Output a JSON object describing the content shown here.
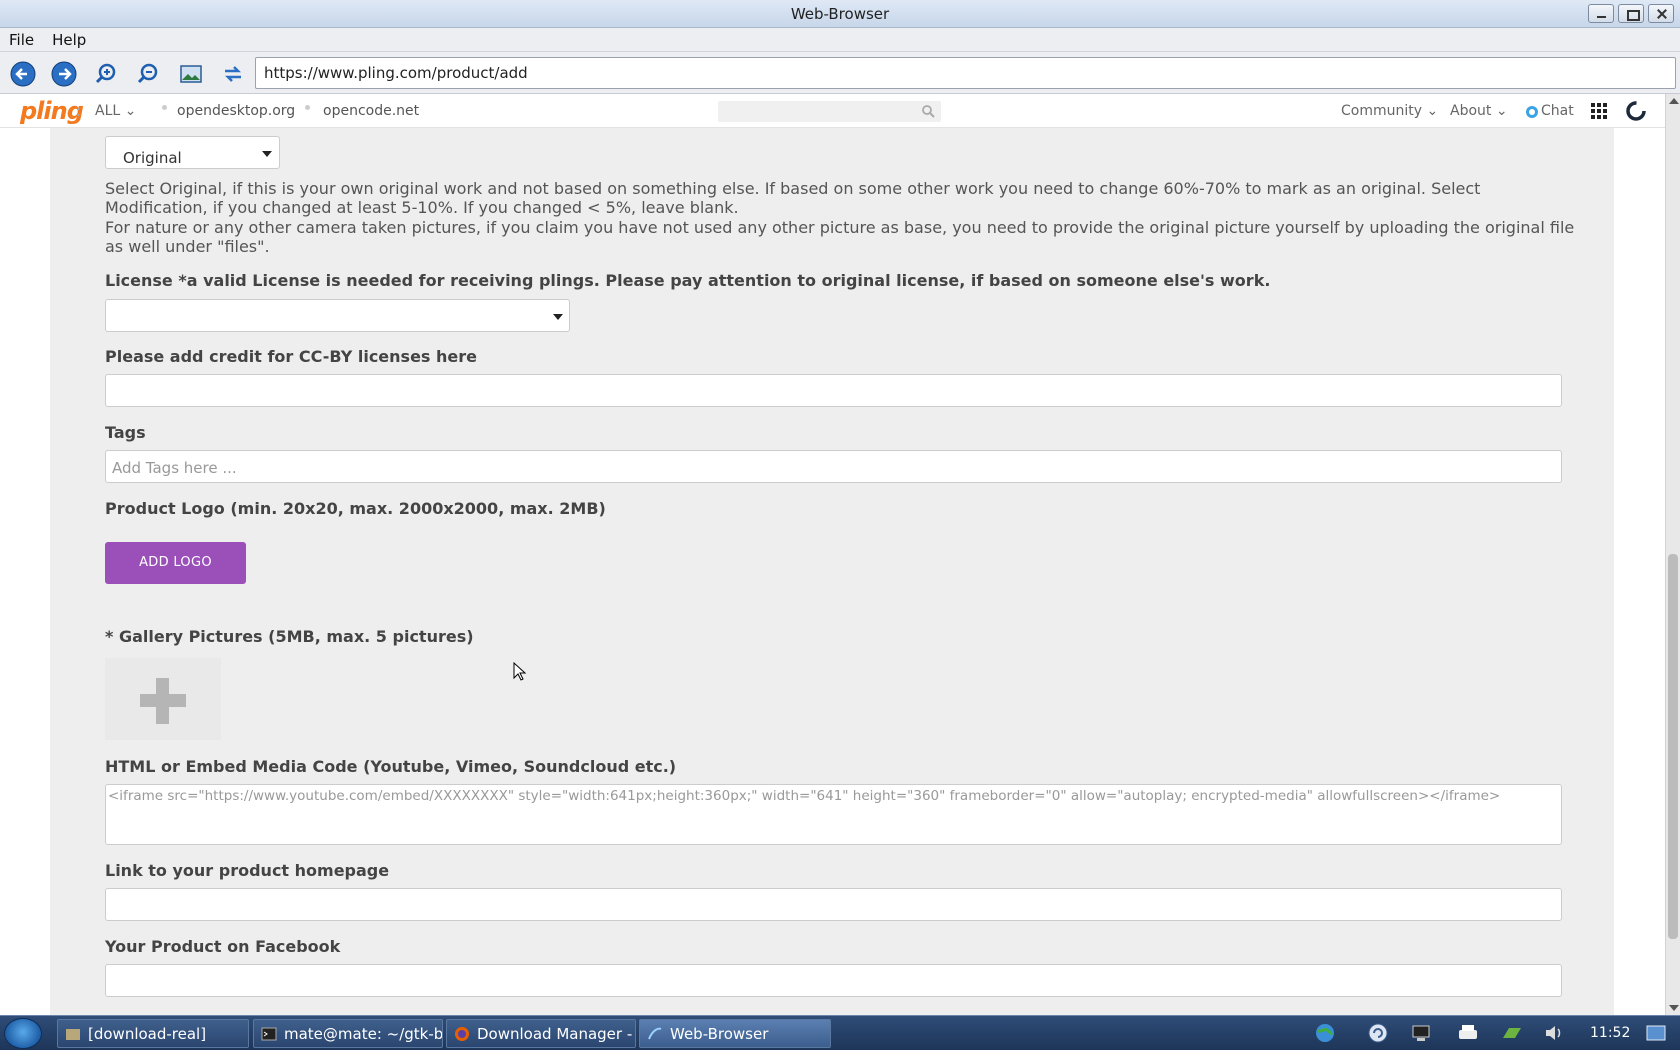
{
  "window": {
    "title": "Web-Browser"
  },
  "menubar": {
    "file": "File",
    "help": "Help"
  },
  "toolbar": {
    "url": "https://www.pling.com/product/add"
  },
  "site": {
    "logo": "pling",
    "colon": ":",
    "all": "ALL ⌄",
    "links": [
      "opendesktop.org",
      "opencode.net"
    ],
    "community": "Community ⌄",
    "about": "About ⌄",
    "chat": "Chat"
  },
  "form": {
    "original_select": "Original",
    "original_help_1": "Select Original, if this is your own original work and not based on something else. If based on some other work you need to change 60%-70% to mark as an original. Select Modification, if you changed at least 5-10%. If you changed < 5%, leave blank.",
    "original_help_2": "For nature or any other camera taken pictures, if you claim you have not used any other picture as base, you need to provide the original picture yourself by uploading the original file as well under \"files\".",
    "license_label": "License *a valid License is needed for receiving plings. Please pay attention to original license, if based on someone else's work.",
    "license_value": "",
    "credit_label": "Please add credit for CC-BY licenses here",
    "credit_value": "",
    "tags_label": "Tags",
    "tags_placeholder": "Add Tags here ...",
    "logo_label": "Product Logo (min. 20x20, max. 2000x2000, max. 2MB)",
    "logo_button": "ADD LOGO",
    "gallery_label": "* Gallery Pictures (5MB, max. 5 pictures)",
    "embed_label": "HTML or Embed Media Code (Youtube, Vimeo, Soundcloud etc.)",
    "embed_placeholder": "<iframe src=\"https://www.youtube.com/embed/XXXXXXXX\" style=\"width:641px;height:360px;\" width=\"641\" height=\"360\" frameborder=\"0\" allow=\"autoplay; encrypted-media\" allowfullscreen></iframe>",
    "homepage_label": "Link to your product homepage",
    "homepage_value": "",
    "facebook_label": "Your Product on Facebook",
    "facebook_value": ""
  },
  "taskbar": {
    "tasks": [
      "[download-real]",
      "mate@mate: ~/gtk-br...",
      "Download Manager - ...",
      "Web-Browser"
    ],
    "clock": "11:52"
  },
  "colors": {
    "accent": "#9a50b8",
    "brand": "#f47a20"
  }
}
